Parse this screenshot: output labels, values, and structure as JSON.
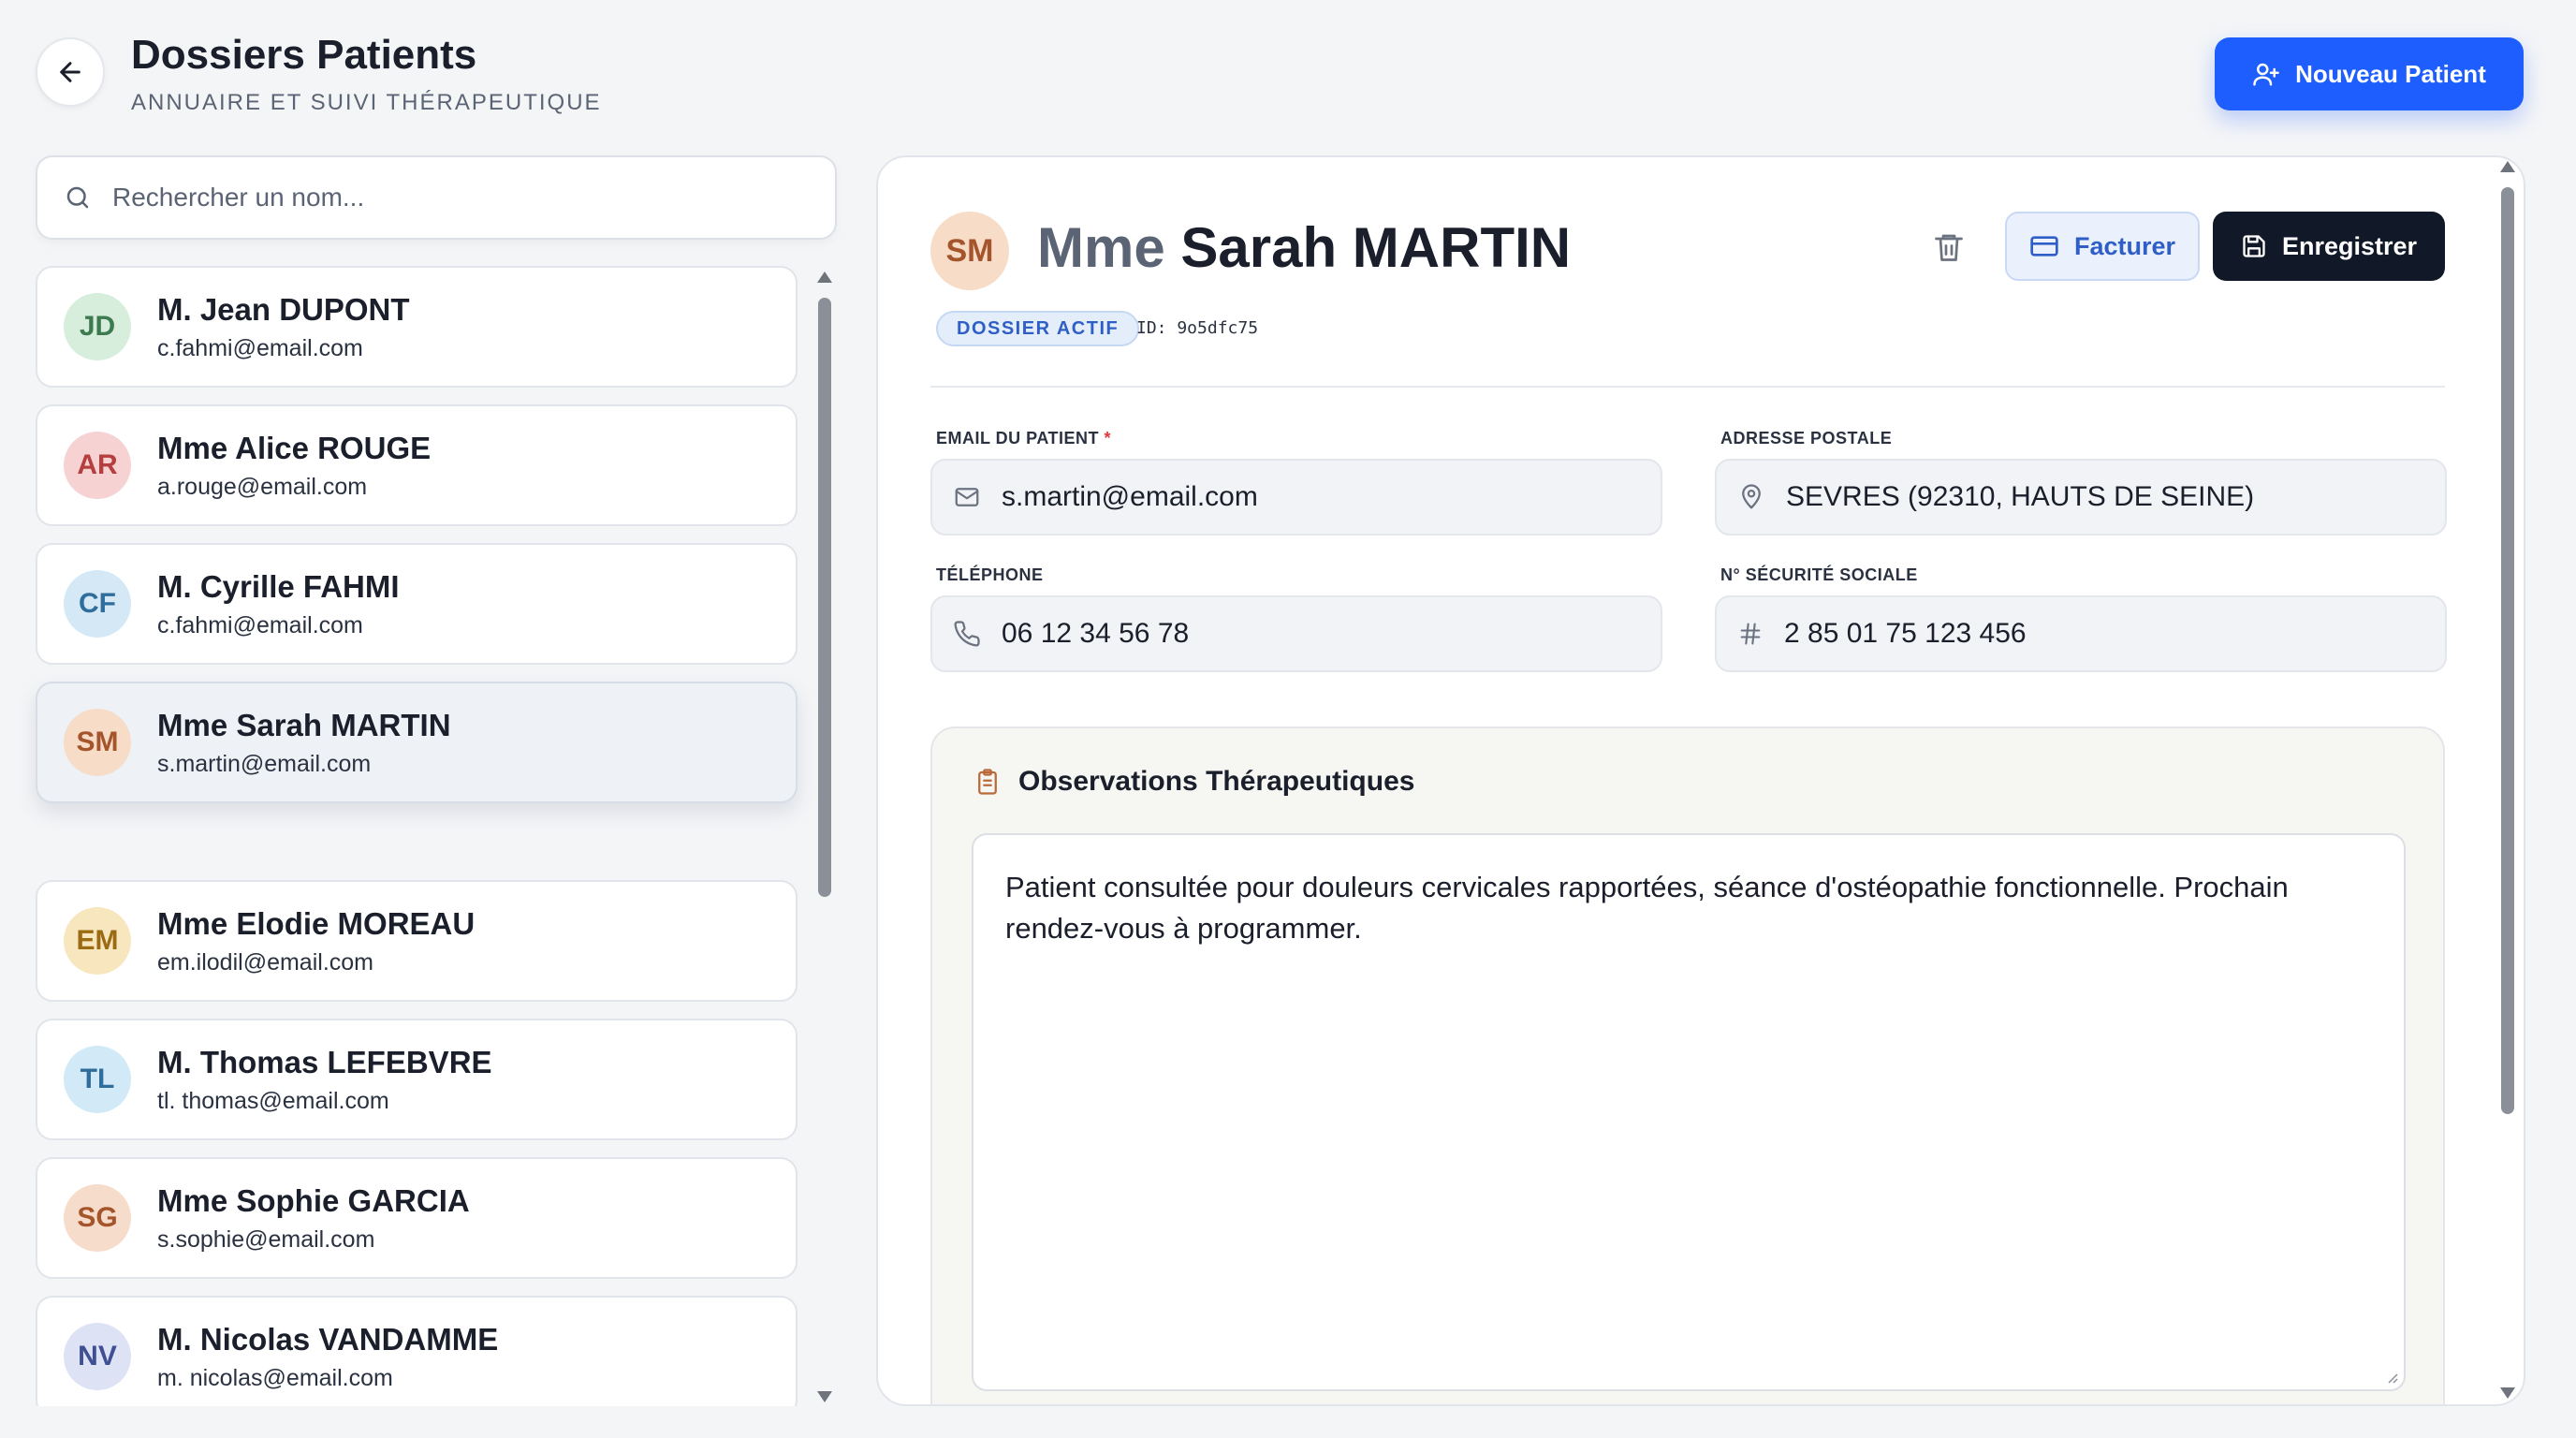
{
  "header": {
    "title": "Dossiers Patients",
    "subtitle": "ANNUAIRE ET SUIVI THÉRAPEUTIQUE",
    "new_patient_label": "Nouveau Patient"
  },
  "search": {
    "placeholder": "Rechercher un nom..."
  },
  "patients": [
    {
      "initials": "JD",
      "name": "M. Jean DUPONT",
      "email": "c.fahmi@email.com",
      "bg": "#d6eedb",
      "fg": "#3d7a50"
    },
    {
      "initials": "AR",
      "name": "Mme Alice ROUGE",
      "email": "a.rouge@email.com",
      "bg": "#f6d2d2",
      "fg": "#b53f3f"
    },
    {
      "initials": "CF",
      "name": "M. Cyrille FAHMI",
      "email": "c.fahmi@email.com",
      "bg": "#d4e8f6",
      "fg": "#2f6d9c"
    },
    {
      "initials": "SM",
      "name": "Mme Sarah MARTIN",
      "email": "s.martin@email.com",
      "bg": "#f7dcc8",
      "fg": "#a4552c"
    },
    {
      "initials": "EM",
      "name": "Mme Elodie MOREAU",
      "email": "em.ilodil@email.com",
      "bg": "#f8e6bf",
      "fg": "#9b6b14"
    },
    {
      "initials": "TL",
      "name": "M. Thomas LEFEBVRE",
      "email": "tl. thomas@email.com",
      "bg": "#d2e9f7",
      "fg": "#2f6d9c"
    },
    {
      "initials": "SG",
      "name": "Mme Sophie GARCIA",
      "email": "s.sophie@email.com",
      "bg": "#f6dccb",
      "fg": "#a4552c"
    },
    {
      "initials": "NV",
      "name": "M. Nicolas VANDAMME",
      "email": "m. nicolas@email.com",
      "bg": "#dde2f4",
      "fg": "#3e4f94"
    }
  ],
  "selected_patient_index": 3,
  "detail": {
    "initials": "SM",
    "civility": "Mme",
    "name": "Sarah MARTIN",
    "bill_label": "Facturer",
    "save_label": "Enregistrer",
    "status_badge": "DOSSIER ACTIF",
    "record_id": "ID: 9o5dfc75",
    "email_label": "EMAIL DU PATIENT",
    "email_required_mark": "*",
    "email": "s.martin@email.com",
    "address_label": "ADRESSE POSTALE",
    "address": "SEVRES (92310, HAUTS DE SEINE)",
    "phone_label": "TÉLÉPHONE",
    "phone": "06 12 34 56 78",
    "ssn_label": "N° SÉCURITÉ SOCIALE",
    "ssn": "2 85 01 75 123 456",
    "observations_title": "Observations Thérapeutiques",
    "observations": "Patient consultée pour douleurs cervicales rapportées, séance d'ostéopathie fonctionnelle. Prochain rendez-vous à programmer."
  },
  "colors": {
    "accent": "#1e5eff",
    "dark_button": "#111827",
    "badge": "#2f5fc6"
  },
  "icons": [
    "arrow-left-icon",
    "user-plus-icon",
    "search-icon",
    "trash-icon",
    "credit-card-icon",
    "save-icon",
    "mail-icon",
    "map-pin-icon",
    "phone-icon",
    "hash-icon",
    "clipboard-icon"
  ]
}
